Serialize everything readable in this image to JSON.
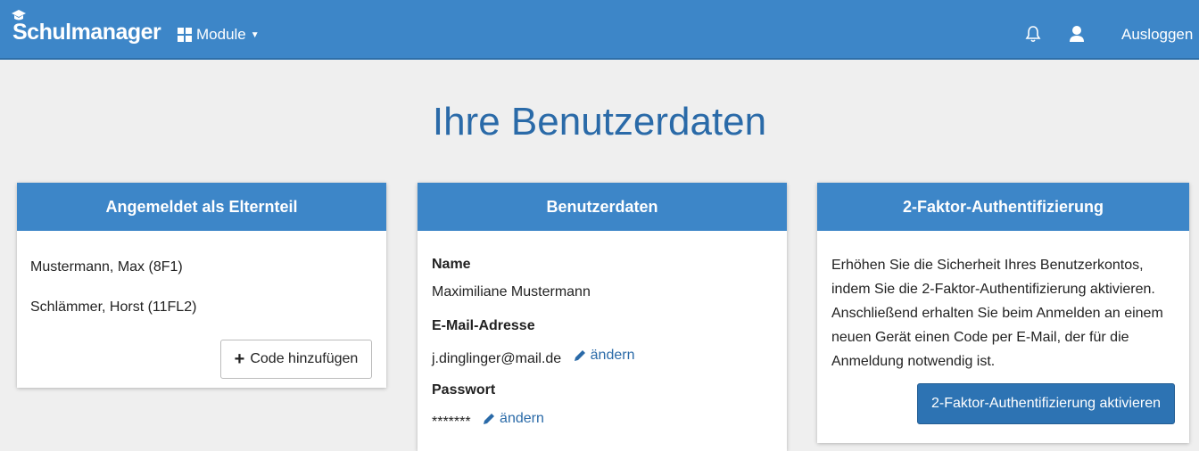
{
  "navbar": {
    "brand": "Schulmanager",
    "modules_label": "Module",
    "logout_label": "Ausloggen"
  },
  "page": {
    "title": "Ihre Benutzerdaten"
  },
  "parent_card": {
    "title": "Angemeldet als Elternteil",
    "children": [
      "Mustermann, Max (8F1)",
      "Schlämmer, Horst (11FL2)"
    ],
    "add_code_label": "Code hinzufügen"
  },
  "user_card": {
    "title": "Benutzerdaten",
    "name_label": "Name",
    "name_value": "Maximiliane Mustermann",
    "email_label": "E-Mail-Adresse",
    "email_value": "j.dinglinger@mail.de",
    "edit_label": "ändern",
    "password_label": "Passwort",
    "password_value": "*******"
  },
  "twofa_card": {
    "title": "2-Faktor-Authentifizierung",
    "description": "Erhöhen Sie die Sicherheit Ihres Benutzerkontos, indem Sie die 2-Faktor-Authentifizierung aktivieren. Anschließend erhalten Sie beim Anmelden an einem neuen Gerät einen Code per E-Mail, der für die Anmeldung notwendig ist.",
    "activate_label": "2-Faktor-Authentifizierung aktivieren"
  },
  "icons": {
    "brand": "graduation-cap-icon",
    "modules": "grid-icon",
    "notifications": "bell-icon",
    "profile": "user-icon",
    "add": "plus-icon",
    "edit": "pencil-icon"
  },
  "colors": {
    "navbar": "#3d86c8",
    "card_header": "#3d86c8",
    "title": "#2a6aa8",
    "link": "#2a6aa8",
    "primary_button": "#2d73b3",
    "background": "#efefef"
  }
}
